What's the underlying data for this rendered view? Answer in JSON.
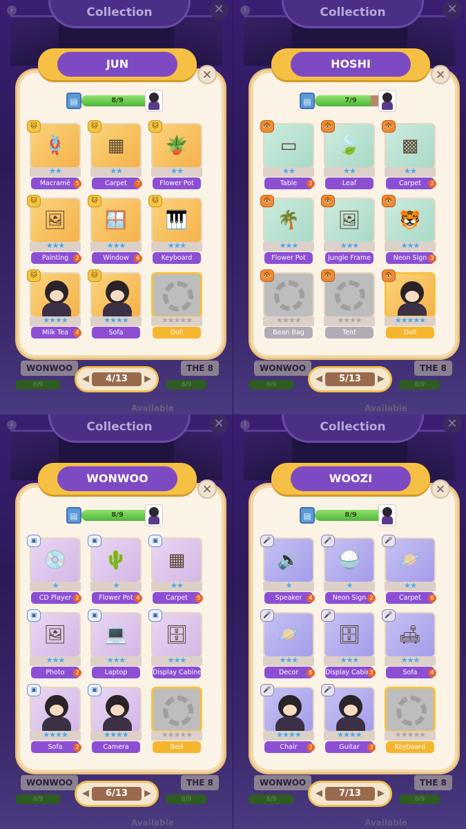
{
  "colors": {
    "ribbon": "#7e4ac4",
    "label": "#8c4fd4",
    "gold": "#f5b52d",
    "stars": "#46a9ef"
  },
  "panels": [
    {
      "collection_title": "Collection",
      "title": "JUN",
      "progress_text": "8/9",
      "progress": 0.889,
      "page": "4/13",
      "bg": {
        "left_name": "WONWOO",
        "right_name": "THE 8",
        "left_prog": "8/9",
        "right_prog": "8/9",
        "available": "Available"
      },
      "badge_icon": "cat-icon",
      "items": [
        {
          "label": "Macramé",
          "stars": "★★",
          "count": "5",
          "tile": "orange",
          "art": "🪢",
          "state": "owned"
        },
        {
          "label": "Carpet",
          "stars": "★★",
          "count": "7",
          "tile": "orange",
          "art": "▦",
          "state": "owned"
        },
        {
          "label": "Flower Pot",
          "stars": "★★",
          "count": "",
          "tile": "orange",
          "art": "🪴",
          "state": "owned"
        },
        {
          "label": "Painting",
          "stars": "★★★",
          "count": "2",
          "tile": "orange",
          "art": "🖼",
          "state": "owned"
        },
        {
          "label": "Window",
          "stars": "★★★",
          "count": "6",
          "tile": "orange",
          "art": "🪟",
          "state": "owned"
        },
        {
          "label": "Keyboard",
          "stars": "★★★",
          "count": "",
          "tile": "orange",
          "art": "🎹",
          "state": "owned"
        },
        {
          "label": "Milk Tea",
          "stars": "★★★★",
          "count": "4",
          "tile": "orange",
          "art": "",
          "state": "person"
        },
        {
          "label": "Sofa",
          "stars": "★★★★",
          "count": "",
          "tile": "orange",
          "art": "",
          "state": "person"
        },
        {
          "label": "Doll",
          "stars": "★★★★★",
          "count": "",
          "tile": "gray",
          "art": "",
          "state": "locked"
        }
      ]
    },
    {
      "collection_title": "Collection",
      "title": "HOSHI",
      "progress_text": "7/9",
      "progress": 0.778,
      "page": "5/13",
      "bg": {
        "left_name": "WONWOO",
        "right_name": "THE 8",
        "left_prog": "8/9",
        "right_prog": "8/9",
        "available": "Available"
      },
      "badge_icon": "tiger-icon",
      "items": [
        {
          "label": "Table",
          "stars": "★★",
          "count": "2",
          "tile": "mint",
          "art": "▭",
          "state": "owned"
        },
        {
          "label": "Leaf",
          "stars": "★★",
          "count": "",
          "tile": "mint",
          "art": "🍃",
          "state": "owned"
        },
        {
          "label": "Carpet",
          "stars": "★★",
          "count": "2",
          "tile": "mint",
          "art": "▩",
          "state": "owned"
        },
        {
          "label": "Flower Pot",
          "stars": "★★★",
          "count": "",
          "tile": "mint",
          "art": "🌴",
          "state": "owned"
        },
        {
          "label": "Jungle Frame",
          "stars": "★★★",
          "count": "",
          "tile": "mint",
          "art": "🖼",
          "state": "owned"
        },
        {
          "label": "Neon Sign",
          "stars": "★★★",
          "count": "3",
          "tile": "mint",
          "art": "🐯",
          "state": "owned"
        },
        {
          "label": "Bean Bag",
          "stars": "★★★★",
          "count": "",
          "tile": "gray",
          "art": "",
          "state": "locked_gray"
        },
        {
          "label": "Tent",
          "stars": "★★★★",
          "count": "",
          "tile": "gray",
          "art": "",
          "state": "locked_gray"
        },
        {
          "label": "Doll",
          "stars": "★★★★★",
          "count": "",
          "tile": "orange",
          "art": "",
          "state": "gold_person"
        }
      ]
    },
    {
      "collection_title": "Collection",
      "title": "WONWOO",
      "progress_text": "8/9",
      "progress": 0.889,
      "page": "6/13",
      "bg": {
        "left_name": "WONWOO",
        "right_name": "THE 8",
        "left_prog": "8/9",
        "right_prog": "8/9",
        "available": "Available"
      },
      "badge_icon": "phone-icon",
      "items": [
        {
          "label": "CD Player",
          "stars": "★",
          "count": "2",
          "tile": "lilac",
          "art": "💿",
          "state": "owned"
        },
        {
          "label": "Flower Pot",
          "stars": "★",
          "count": "4",
          "tile": "lilac",
          "art": "🌵",
          "state": "owned"
        },
        {
          "label": "Carpet",
          "stars": "★★",
          "count": "5",
          "tile": "lilac",
          "art": "▦",
          "state": "owned"
        },
        {
          "label": "Photo",
          "stars": "★★★",
          "count": "2",
          "tile": "lilac",
          "art": "🖼",
          "state": "owned"
        },
        {
          "label": "Laptop",
          "stars": "★★★",
          "count": "",
          "tile": "lilac",
          "art": "💻",
          "state": "owned"
        },
        {
          "label": "Display Cabinet",
          "stars": "★★★",
          "count": "",
          "tile": "lilac",
          "art": "🗄",
          "state": "owned"
        },
        {
          "label": "Sofa",
          "stars": "★★★★",
          "count": "2",
          "tile": "lilac",
          "art": "",
          "state": "person"
        },
        {
          "label": "Camera",
          "stars": "★★★★",
          "count": "",
          "tile": "lilac",
          "art": "",
          "state": "person"
        },
        {
          "label": "Bed",
          "stars": "★★★★★",
          "count": "",
          "tile": "gray",
          "art": "",
          "state": "locked"
        }
      ]
    },
    {
      "collection_title": "Collection",
      "title": "WOOZI",
      "progress_text": "8/9",
      "progress": 0.889,
      "page": "7/13",
      "bg": {
        "left_name": "WONWOO",
        "right_name": "THE 8",
        "left_prog": "8/9",
        "right_prog": "8/9",
        "available": "Available"
      },
      "badge_icon": "microphone-icon",
      "items": [
        {
          "label": "Speaker",
          "stars": "★",
          "count": "4",
          "tile": "purple",
          "art": "🔊",
          "state": "owned"
        },
        {
          "label": "Neon Sign",
          "stars": "★",
          "count": "2",
          "tile": "purple",
          "art": "🍚",
          "state": "owned"
        },
        {
          "label": "Carpet",
          "stars": "★★",
          "count": "6",
          "tile": "purple",
          "art": "🪐",
          "state": "owned"
        },
        {
          "label": "Decor",
          "stars": "★★★",
          "count": "6",
          "tile": "purple",
          "art": "🪐",
          "state": "owned"
        },
        {
          "label": "Display Cabinet",
          "stars": "★★★",
          "count": "3",
          "tile": "purple",
          "art": "🗄",
          "state": "owned"
        },
        {
          "label": "Sofa",
          "stars": "★★★",
          "count": "4",
          "tile": "purple",
          "art": "🛋",
          "state": "owned"
        },
        {
          "label": "Chair",
          "stars": "★★★★",
          "count": "2",
          "tile": "purple",
          "art": "",
          "state": "person"
        },
        {
          "label": "Guitar",
          "stars": "★★★★",
          "count": "3",
          "tile": "purple",
          "art": "",
          "state": "person"
        },
        {
          "label": "Keyboard",
          "stars": "★★★★★",
          "count": "",
          "tile": "gray",
          "art": "",
          "state": "locked"
        }
      ]
    }
  ]
}
